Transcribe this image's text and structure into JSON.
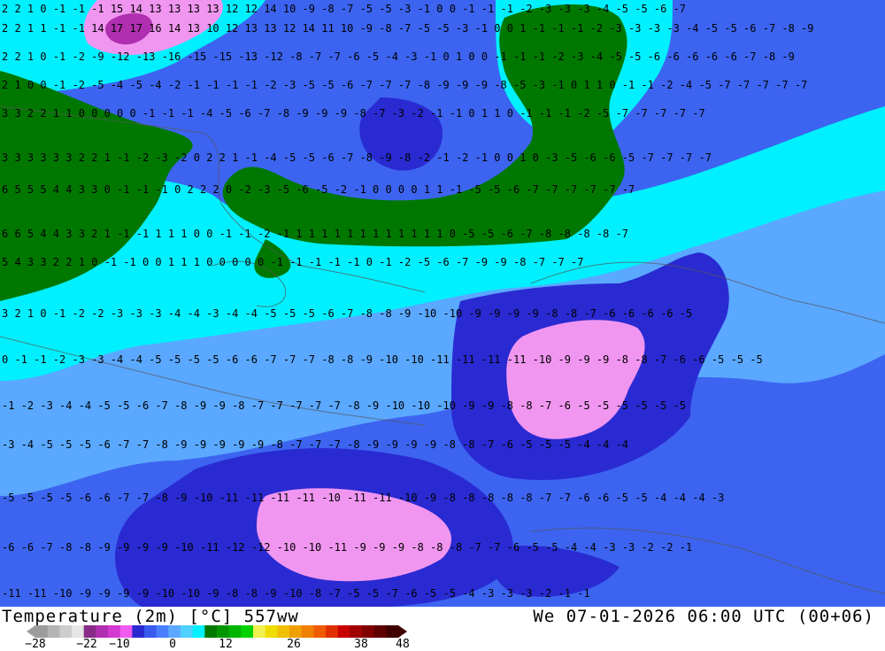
{
  "map": {
    "title_left": "Temperature (2m) [°C] 557ww",
    "title_right": "We 07-01-2026 06:00 UTC (00+06)",
    "colorbar": {
      "colors": [
        "#9c9c9c",
        "#b4b4b4",
        "#cdcdcd",
        "#e6e6e6",
        "#8a2b8a",
        "#b02fb0",
        "#d23ad2",
        "#f05af0",
        "#2a2ad2",
        "#3a5af0",
        "#4a80ff",
        "#5aa8ff",
        "#50d0ff",
        "#00f0ff",
        "#007800",
        "#009600",
        "#00b400",
        "#00d200",
        "#f0f050",
        "#f0dc00",
        "#f0c000",
        "#f0a000",
        "#f08000",
        "#f05a00",
        "#e03000",
        "#c80000",
        "#a00000",
        "#800000",
        "#600000",
        "#400000"
      ],
      "tick_labels": [
        "-28",
        "-22",
        "-10",
        "0",
        "12",
        "26",
        "38",
        "48"
      ]
    },
    "contour_label_rows": [
      "2 2 1 0 -1 -1 -1 15 14 13 13 13 13 12 12 14 10 -9 -8 -7 -5 -5 -3 -1 0 0 -1 -1 -1 -2 -3 -3 -3 -4 -5 -5 -6 -7",
      "2 2 1 1 -1 -1 14 17 17 16 14 13 10 12 13 13 12 14 11 10 -9 -8 -7 -5 -5 -3 -1 0 0 1 -1 -1 -1 -2 -3 -3 -3 -3 -4 -5 -5 -6 -7 -8 -9",
      "2 2 1 0 -1 -2 -9 -12 -13 -16 -15 -15 -13 -12 -8 -7 -7 -6 -5 -4 -3 -1 0 1 0 0 -1 -1 -1 -2 -3 -4 -5 -5 -6 -6 -6 -6 -6 -7 -8 -9",
      "2 1 0 0 -1 -2 -5 -4 -5 -4 -2 -1 -1 -1 -1 -2 -3 -5 -5 -6 -7 -7 -7 -8 -9 -9 -9 -8 -5 -3 -1 0 1 1 0 -1 -1 -2 -4 -5 -7 -7 -7 -7 -7",
      "3 3 2 2 1 1 0 0 0 0 0 -1 -1 -1 -4 -5 -6 -7 -8 -9 -9 -9 -8 -7 -3 -2 -1 -1 0 1 1 0 -1 -1 -1 -2 -5 -7 -7 -7 -7 -7",
      "3 3 3 3 3 3 2 2 1 -1 -2 -3 -2 0 2 2 1 -1 -4 -5 -5 -6 -7 -8 -9 -8 -2 -1 -2 -1 0 0 1 0 -3 -5 -6 -6 -5 -7 -7 -7 -7",
      "6 5 5 5 4 4 3 3 0 -1 -1 -1 0 2 2 2 0 -2 -3 -5 -6 -5 -2 -1 0 0 0 0 1 1 -1 -5 -5 -6 -7 -7 -7 -7 -7 -7",
      "6 6 5 4 4 3 3 2 1 -1 -1 1 1 1 0 0 -1 -1 -2 -1 1 1 1 1 1 1 1 1 1 1 1 1 0 -5 -5 -6 -7 -8 -8 -8 -8 -7",
      "5 4 3 3 2 2 1 0 -1 -1 0 0 1 1 1 0 0 0 0 0 -1 -1 -1 -1 -1 0 -1 -2 -5 -6 -7 -9 -9 -8 -7 -7 -7",
      "3 2 1 0 -1 -2 -2 -3 -3 -3 -4 -4 -3 -4 -4 -5 -5 -5 -6 -7 -8 -8 -9 -10 -10 -9 -9 -9 -9 -8 -8 -7 -6 -6 -6 -6 -5",
      "0 -1 -1 -2 -3 -3 -4 -4 -5 -5 -5 -5 -6 -6 -7 -7 -7 -8 -8 -9 -10 -10 -11 -11 -11 -11 -10 -9 -9 -9 -8 -8 -7 -6 -6 -5 -5 -5",
      "-1 -2 -3 -4 -4 -5 -5 -6 -7 -8 -9 -9 -8 -7 -7 -7 -7 -7 -8 -9 -10 -10 -10 -9 -9 -8 -8 -7 -6 -5 -5 -5 -5 -5 -5",
      "-3 -4 -5 -5 -5 -6 -7 -7 -8 -9 -9 -9 -9 -9 -8 -7 -7 -7 -8 -9 -9 -9 -9 -8 -8 -7 -6 -5 -5 -5 -4 -4 -4",
      "-5 -5 -5 -5 -6 -6 -7 -7 -8 -9 -10 -11 -11 -11 -11 -10 -11 -11 -10 -9 -8 -8 -8 -8 -8 -7 -7 -6 -6 -5 -5 -4 -4 -4 -3",
      "-6 -6 -7 -8 -8 -9 -9 -9 -9 -10 -11 -12 -12 -10 -10 -11 -9 -9 -9 -8 -8 -8 -7 -7 -6 -5 -5 -4 -4 -3 -3 -2 -2 -1",
      "-11 -11 -10 -9 -9 -9 -9 -10 -10 -9 -8 -8 -9 -10 -8 -7 -5 -5 -7 -6 -5 -5 -4 -3 -3 -3 -2 -1 -1"
    ]
  }
}
